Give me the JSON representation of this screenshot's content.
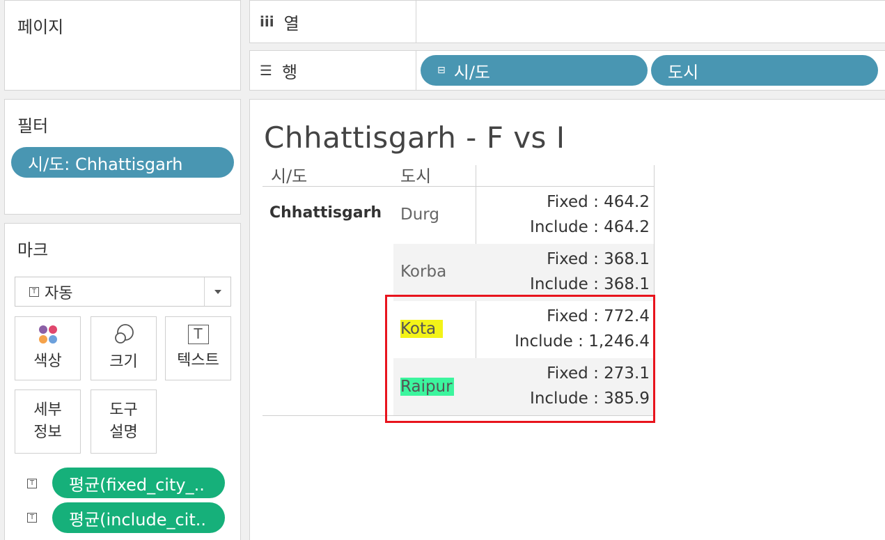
{
  "pages": {
    "title": "페이지"
  },
  "filters": {
    "title": "필터",
    "pill": "시/도: Chhattisgarh"
  },
  "marks": {
    "title": "마크",
    "type_label": "자동",
    "buttons": {
      "color": "색상",
      "size": "크기",
      "text": "텍스트",
      "detail_l1": "세부",
      "detail_l2": "정보",
      "tooltip_l1": "도구",
      "tooltip_l2": "설명"
    },
    "fields": [
      "평균(fixed_city_..",
      "평균(include_cit.."
    ]
  },
  "shelves": {
    "columns_label": "열",
    "rows_label": "행",
    "row_pills": [
      "시/도",
      "도시"
    ]
  },
  "viz": {
    "title": "Chhattisgarh - F vs I",
    "headers": {
      "state": "시/도",
      "city": "도시"
    },
    "state": "Chhattisgarh",
    "rows": [
      {
        "city": "Durg",
        "fixed": "Fixed : 464.2",
        "include": "Include : 464.2"
      },
      {
        "city": "Korba",
        "fixed": "Fixed : 368.1",
        "include": "Include : 368.1"
      },
      {
        "city": "Kota",
        "fixed": "Fixed : 772.4",
        "include": "Include : 1,246.4"
      },
      {
        "city": "Raipur",
        "fixed": "Fixed : 273.1",
        "include": "Include : 385.9"
      }
    ]
  },
  "colors": {
    "blue_pill": "#4996b2",
    "green_pill": "#16b07a",
    "highlight_box": "#e8141d",
    "highlight_yellow": "#f3f318",
    "highlight_green": "#3cf59e"
  }
}
